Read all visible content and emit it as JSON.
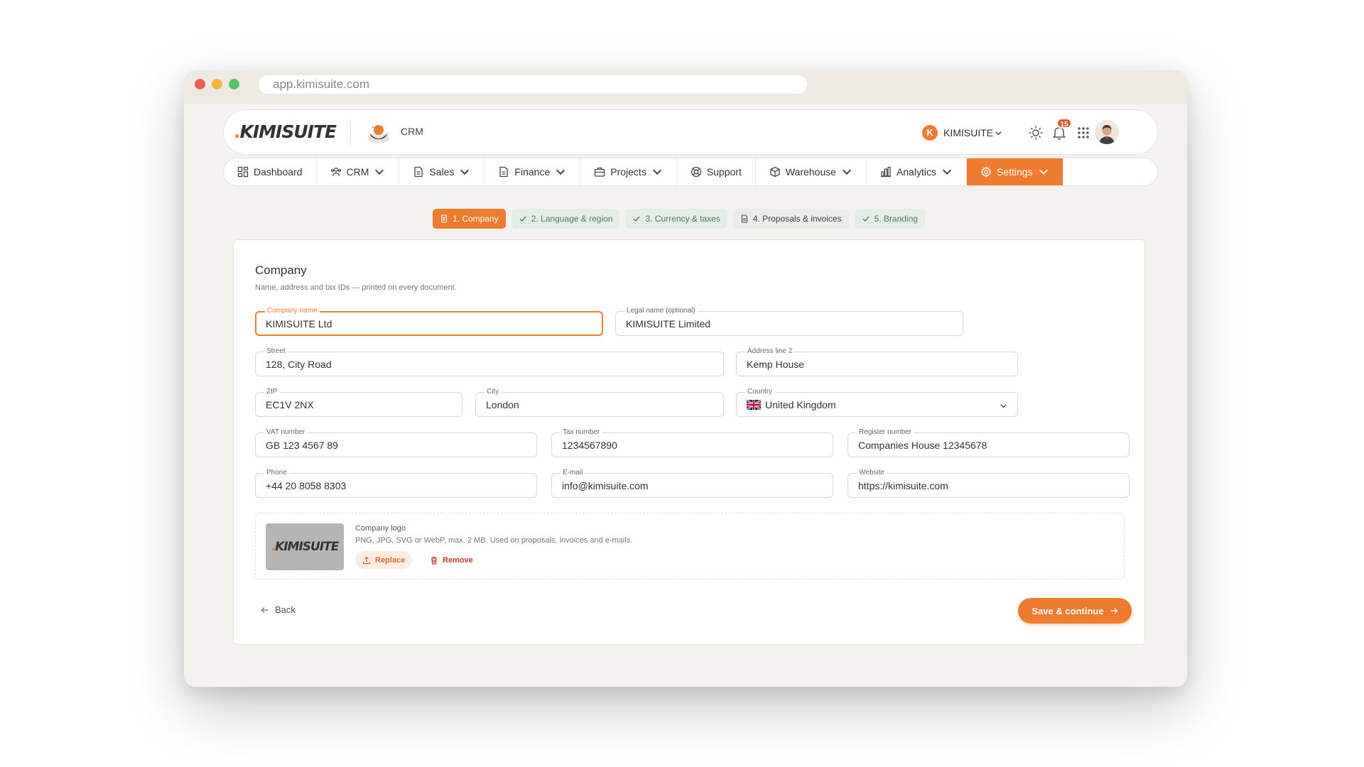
{
  "browser": {
    "url": "app.kimisuite.com"
  },
  "header": {
    "logo": {
      "prefix": ".",
      "text": "KIMISUITE"
    },
    "module_label": "CRM",
    "account": {
      "initial": "K",
      "name": "KIMISUITE"
    },
    "notification_count": "15"
  },
  "nav": {
    "items": [
      {
        "label": "Dashboard",
        "icon": "dashboard-icon"
      },
      {
        "label": "CRM",
        "icon": "users-icon"
      },
      {
        "label": "Sales",
        "icon": "document-icon"
      },
      {
        "label": "Finance",
        "icon": "document-icon"
      },
      {
        "label": "Projects",
        "icon": "briefcase-icon"
      },
      {
        "label": "Support",
        "icon": "lifebuoy-icon"
      },
      {
        "label": "Warehouse",
        "icon": "box-icon"
      },
      {
        "label": "Analytics",
        "icon": "bar-chart-icon"
      },
      {
        "label": "Settings",
        "icon": "gear-icon",
        "active": true
      }
    ]
  },
  "steps": [
    {
      "label": "1. Company",
      "state": "active"
    },
    {
      "label": "2. Language & region",
      "state": "done"
    },
    {
      "label": "3. Currency & taxes",
      "state": "done"
    },
    {
      "label": "4. Proposals & invoices",
      "state": "pending"
    },
    {
      "label": "5. Branding",
      "state": "done"
    }
  ],
  "form": {
    "title": "Company",
    "subtitle": "Name, address and tax IDs — printed on every document.",
    "company_name": {
      "label": "Company name",
      "value": "KIMISUITE Ltd"
    },
    "legal_name": {
      "label": "Legal name (optional)",
      "value": "KIMISUITE Limited"
    },
    "street": {
      "label": "Street",
      "value": "128, City Road"
    },
    "address2": {
      "label": "Address line 2",
      "value": "Kemp House"
    },
    "zip": {
      "label": "ZIP",
      "value": "EC1V 2NX"
    },
    "city": {
      "label": "City",
      "value": "London"
    },
    "country": {
      "label": "Country",
      "value": "United Kingdom"
    },
    "vat": {
      "label": "VAT number",
      "value": "GB 123 4567 89"
    },
    "tax": {
      "label": "Tax number",
      "value": "1234567890"
    },
    "register": {
      "label": "Register number",
      "value": "Companies House 12345678"
    },
    "phone": {
      "label": "Phone",
      "value": "+44 20 8058 8303"
    },
    "email": {
      "label": "E-mail",
      "value": "info@kimisuite.com"
    },
    "website": {
      "label": "Website",
      "value": "https://kimisuite.com"
    }
  },
  "logo_section": {
    "title": "Company logo",
    "description": "PNG, JPG, SVG or WebP, max. 2 MB. Used on proposals, invoices and e-mails.",
    "replace_label": "Replace",
    "remove_label": "Remove",
    "thumb_prefix": ".",
    "thumb_text": "KIMISUITE"
  },
  "footer": {
    "back_label": "Back",
    "save_label": "Save & continue"
  },
  "colors": {
    "accent": "#ef7b2e",
    "done": "#4c7d5c",
    "danger": "#c0392b"
  }
}
